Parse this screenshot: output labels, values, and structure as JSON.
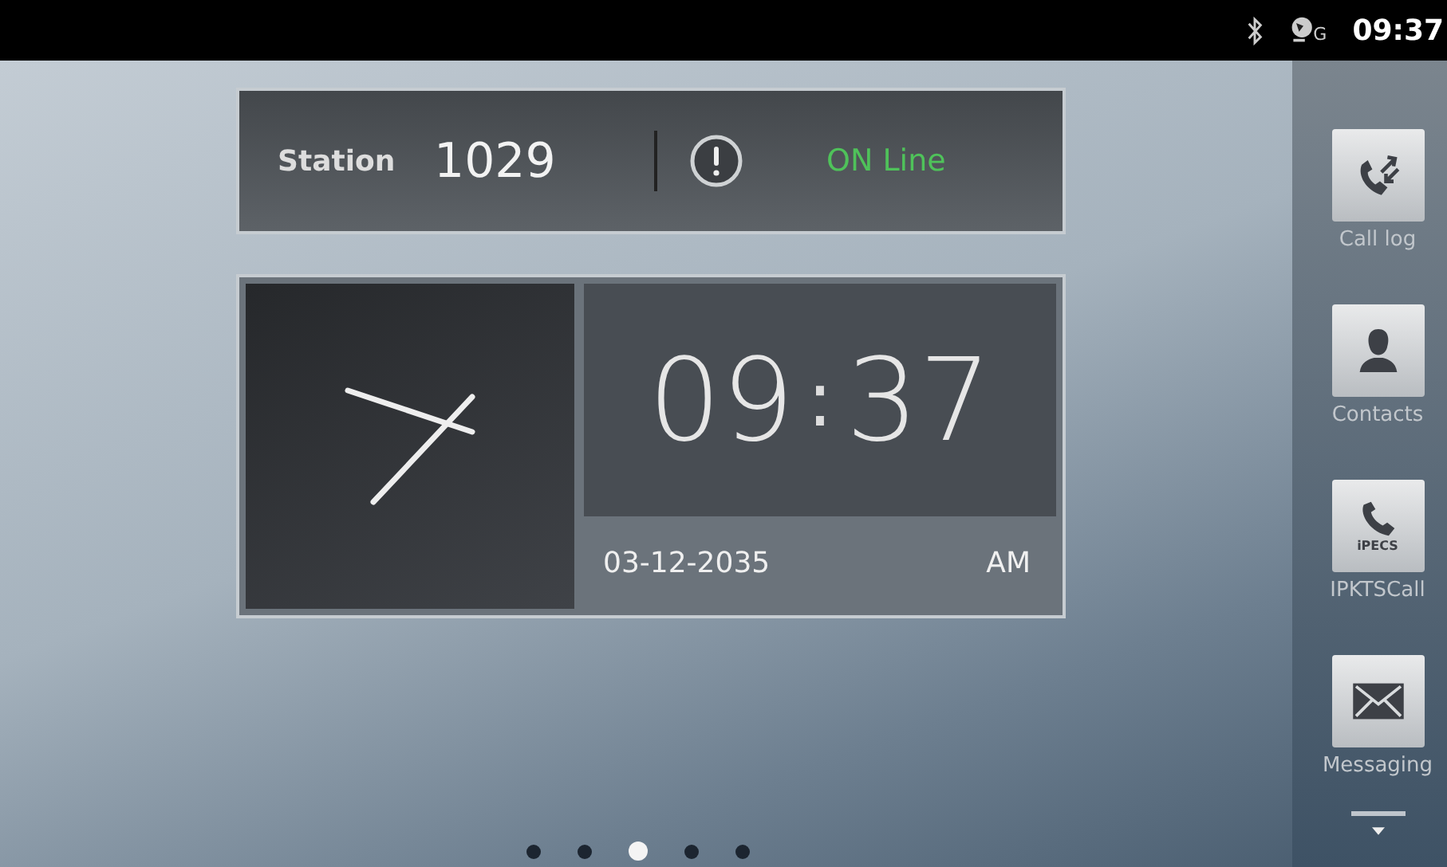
{
  "status_bar": {
    "time": "09:37",
    "network_letter": "G"
  },
  "station": {
    "label": "Station",
    "number": "1029",
    "status": "ON Line"
  },
  "clock": {
    "time_hours": "09",
    "separator": ":",
    "time_minutes": "37",
    "date": "03-12-2035",
    "meridiem": "AM"
  },
  "page_indicator": [
    {
      "selected": false
    },
    {
      "selected": false
    },
    {
      "selected": true
    },
    {
      "selected": false
    },
    {
      "selected": false
    }
  ],
  "dock": [
    {
      "kind": "call-log",
      "label": "Call log"
    },
    {
      "kind": "contacts",
      "label": "Contacts"
    },
    {
      "kind": "phone",
      "label": "IPKTSCall",
      "logo_text": "iPECS"
    },
    {
      "kind": "messaging",
      "label": "Messaging"
    }
  ]
}
